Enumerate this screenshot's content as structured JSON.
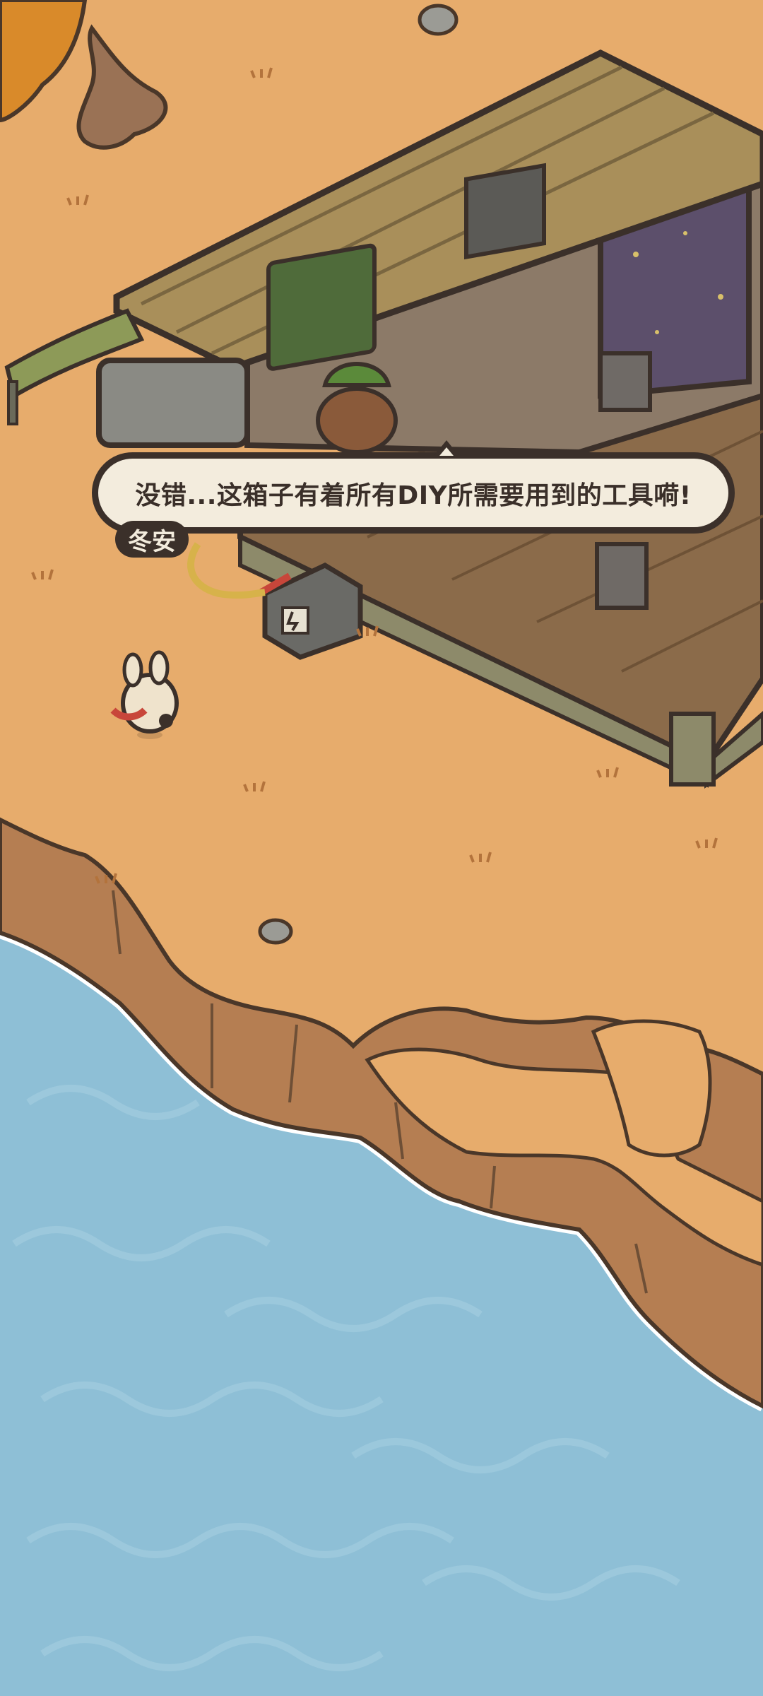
{
  "dialog": {
    "text": "没错...这箱子有着所有DIY所需要用到的工具嗬!",
    "speaker": "冬安"
  },
  "colors": {
    "sand": "#e7ac6c",
    "water": "#8ebfd6",
    "cliff": "#b57e52",
    "wood": "#8b6b4a",
    "dialog_bg": "#f3ecdd",
    "dialog_border": "#3b302a"
  }
}
